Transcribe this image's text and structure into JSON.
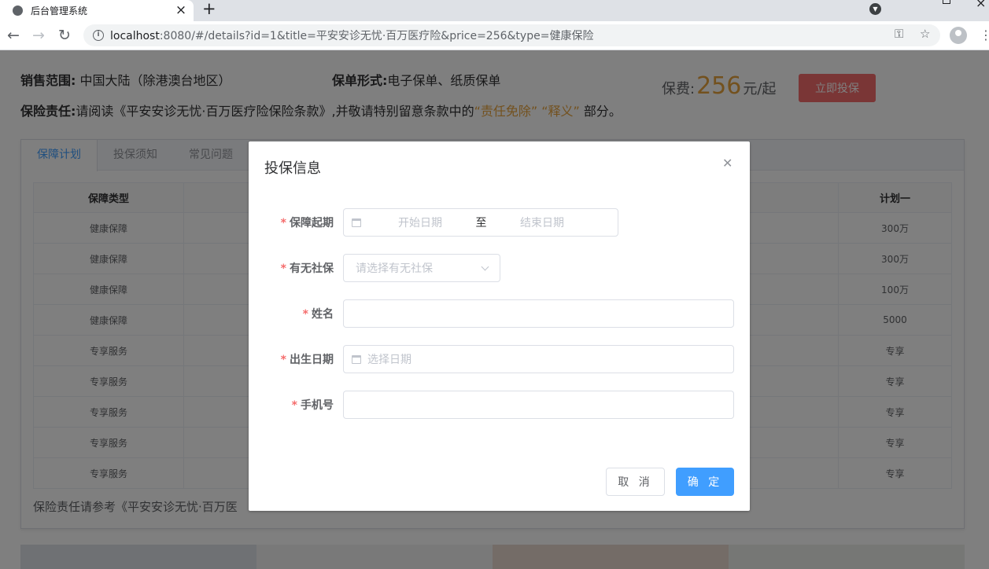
{
  "browser": {
    "tab_title": "后台管理系统",
    "url_host": "localhost",
    "url_rest": ":8080/#/details?id=1&title=平安安诊无忧·百万医疗险&price=256&type=健康保险"
  },
  "product": {
    "sales_label": "销售范围:",
    "sales_value": "中国大陆（除港澳台地区）",
    "form_label": "保单形式:",
    "form_value": "电子保单、纸质保单",
    "duty_label": "保险责任:",
    "duty_text_1": "请阅读《平安安诊无忧·百万医疗险保险条款》,并敬请特别留意条款中的",
    "duty_highlight": "“责任免除” “释义”",
    "duty_text_2": " 部分。",
    "price_label": "保费:",
    "price_value": "256",
    "price_unit": "元/起",
    "buy_label": "立即投保"
  },
  "tabs": [
    "保障计划",
    "投保须知",
    "常见问题"
  ],
  "table": {
    "headers": [
      "保障类型",
      "",
      "计划一"
    ],
    "rows": [
      [
        "健康保障",
        "",
        "300万"
      ],
      [
        "健康保障",
        "",
        "300万"
      ],
      [
        "健康保障",
        "",
        "100万"
      ],
      [
        "健康保障",
        "",
        "5000"
      ],
      [
        "专享服务",
        "",
        "专享"
      ],
      [
        "专享服务",
        "",
        "专享"
      ],
      [
        "专享服务",
        "",
        "专享"
      ],
      [
        "专享服务",
        "",
        "专享"
      ],
      [
        "专享服务",
        "",
        "专享"
      ]
    ]
  },
  "footnote": "保险责任请参考《平安安诊无忧·百万医",
  "dialog": {
    "title": "投保信息",
    "period_label": "保障起期",
    "period_start_placeholder": "开始日期",
    "period_separator": "至",
    "period_end_placeholder": "结束日期",
    "social_label": "有无社保",
    "social_placeholder": "请选择有无社保",
    "name_label": "姓名",
    "birth_label": "出生日期",
    "birth_placeholder": "选择日期",
    "phone_label": "手机号",
    "cancel_label": "取 消",
    "ok_label": "确 定"
  },
  "colors": {
    "primary": "#409eff",
    "danger": "#f56c6c",
    "warning": "#e6a23c"
  }
}
